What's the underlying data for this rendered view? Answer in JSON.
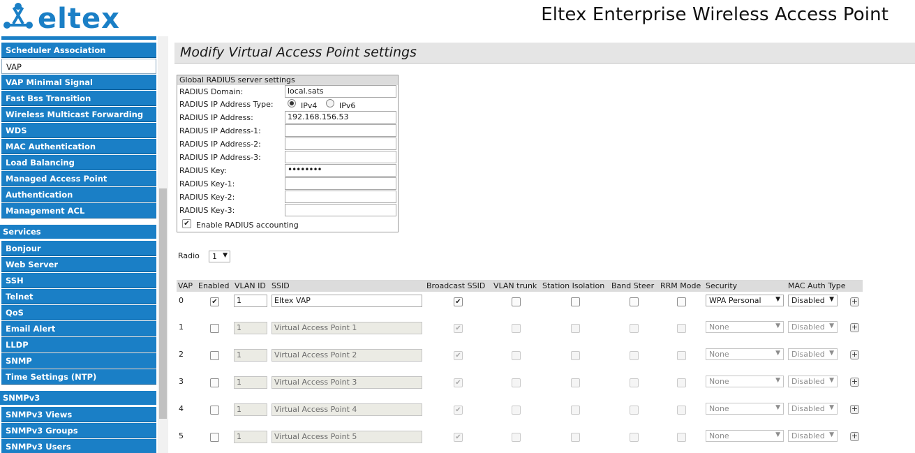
{
  "header": {
    "logo_text": "ELTEX",
    "product_title": "Eltex Enterprise Wireless Access Point",
    "brand_color": "#1a7fc6"
  },
  "sidebar": {
    "group1": [
      {
        "label": "Scheduler Association"
      },
      {
        "label": "VAP",
        "active": true
      },
      {
        "label": "VAP Minimal Signal"
      },
      {
        "label": "Fast Bss Transition"
      },
      {
        "label": "Wireless Multicast Forwarding"
      },
      {
        "label": "WDS"
      },
      {
        "label": "MAC Authentication"
      },
      {
        "label": "Load Balancing"
      },
      {
        "label": "Managed Access Point"
      },
      {
        "label": "Authentication"
      },
      {
        "label": "Management ACL"
      }
    ],
    "services_heading": "Services",
    "services": [
      {
        "label": "Bonjour"
      },
      {
        "label": "Web Server"
      },
      {
        "label": "SSH"
      },
      {
        "label": "Telnet"
      },
      {
        "label": "QoS"
      },
      {
        "label": "Email Alert"
      },
      {
        "label": "LLDP"
      },
      {
        "label": "SNMP"
      },
      {
        "label": "Time Settings (NTP)"
      }
    ],
    "snmpv3_heading": "SNMPv3",
    "snmpv3": [
      {
        "label": "SNMPv3 Views"
      },
      {
        "label": "SNMPv3 Groups"
      },
      {
        "label": "SNMPv3 Users"
      }
    ]
  },
  "main": {
    "page_title": "Modify Virtual Access Point settings",
    "radius": {
      "heading": "Global RADIUS server settings",
      "domain_label": "RADIUS Domain:",
      "domain_value": "local.sats",
      "ip_type_label": "RADIUS IP Address Type:",
      "ipv4_label": "IPv4",
      "ipv6_label": "IPv6",
      "ip_label": "RADIUS IP Address:",
      "ip_value": "192.168.156.53",
      "ip1_label": "RADIUS IP Address-1:",
      "ip1_value": "",
      "ip2_label": "RADIUS IP Address-2:",
      "ip2_value": "",
      "ip3_label": "RADIUS IP Address-3:",
      "ip3_value": "",
      "key_label": "RADIUS Key:",
      "key_value": "••••••••",
      "key1_label": "RADIUS Key-1:",
      "key1_value": "",
      "key2_label": "RADIUS Key-2:",
      "key2_value": "",
      "key3_label": "RADIUS Key-3:",
      "key3_value": "",
      "accounting_label": "Enable RADIUS accounting",
      "accounting_checked": true
    },
    "radio_label": "Radio",
    "radio_value": "1",
    "vap_table": {
      "headers": {
        "vap": "VAP",
        "enabled": "Enabled",
        "vlan_id": "VLAN ID",
        "ssid": "SSID",
        "broadcast": "Broadcast SSID",
        "vlan_trunk": "VLAN trunk",
        "station_isolation": "Station Isolation",
        "band_steer": "Band Steer",
        "rrm_mode": "RRM Mode",
        "security": "Security",
        "mac_auth": "MAC Auth Type"
      },
      "rows": [
        {
          "vap": "0",
          "enabled": true,
          "vlan": "1",
          "ssid": "Eltex VAP",
          "broadcast": true,
          "security": "WPA Personal",
          "mac_auth": "Disabled"
        },
        {
          "vap": "1",
          "enabled": false,
          "vlan": "1",
          "ssid": "Virtual Access Point 1",
          "broadcast": true,
          "security": "None",
          "mac_auth": "Disabled"
        },
        {
          "vap": "2",
          "enabled": false,
          "vlan": "1",
          "ssid": "Virtual Access Point 2",
          "broadcast": true,
          "security": "None",
          "mac_auth": "Disabled"
        },
        {
          "vap": "3",
          "enabled": false,
          "vlan": "1",
          "ssid": "Virtual Access Point 3",
          "broadcast": true,
          "security": "None",
          "mac_auth": "Disabled"
        },
        {
          "vap": "4",
          "enabled": false,
          "vlan": "1",
          "ssid": "Virtual Access Point 4",
          "broadcast": true,
          "security": "None",
          "mac_auth": "Disabled"
        },
        {
          "vap": "5",
          "enabled": false,
          "vlan": "1",
          "ssid": "Virtual Access Point 5",
          "broadcast": true,
          "security": "None",
          "mac_auth": "Disabled"
        }
      ]
    }
  }
}
